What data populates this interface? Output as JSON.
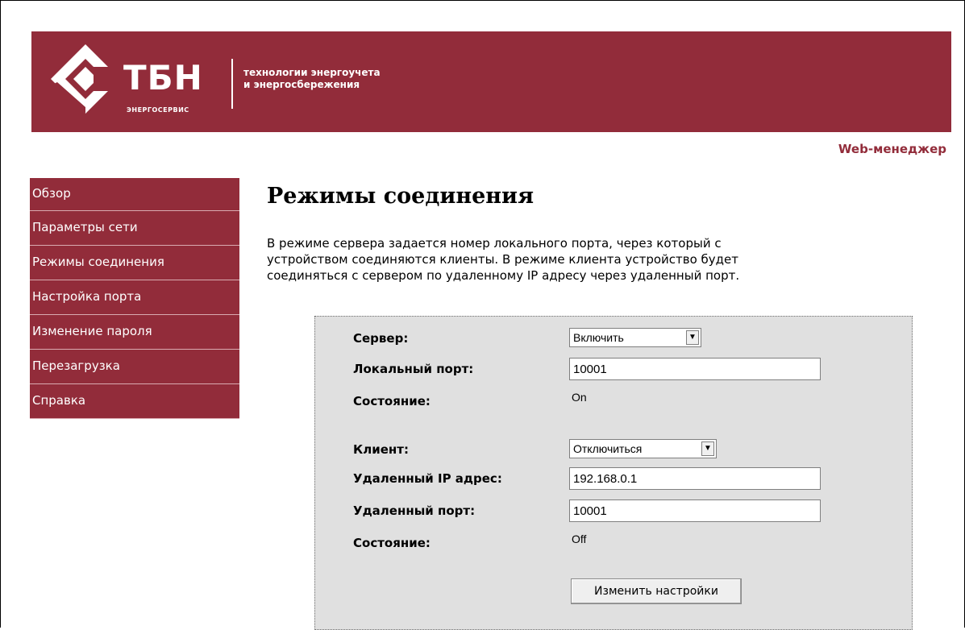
{
  "header": {
    "logo_text": "ТБН",
    "logo_sub": "ЭНЕРГОСЕРВИС",
    "tagline_line1": "технологии энергоучета",
    "tagline_line2": "и энергосбережения",
    "web_manager": "Web-менеджер"
  },
  "sidebar": {
    "items": [
      {
        "label": "Обзор"
      },
      {
        "label": "Параметры сети"
      },
      {
        "label": "Режимы соединения"
      },
      {
        "label": "Настройка порта"
      },
      {
        "label": "Изменение пароля"
      },
      {
        "label": "Перезагрузка"
      },
      {
        "label": "Справка"
      }
    ]
  },
  "main": {
    "title": "Режимы соединения",
    "intro_line1": "В режиме сервера задается номер локального порта, через который с",
    "intro_line2": "устройством соединяются клиенты. В режиме клиента устройство будет",
    "intro_line3": "соединяться с сервером по удаленному IP адресу через удаленный порт."
  },
  "form": {
    "server_label": "Сервер:",
    "server_value": "Включить",
    "local_port_label": "Локальный порт:",
    "local_port_value": "10001",
    "server_state_label": "Состояние:",
    "server_state_value": "On",
    "client_label": "Клиент:",
    "client_value": "Отключиться",
    "remote_ip_label": "Удаленный IP адрес:",
    "remote_ip_value": "192.168.0.1",
    "remote_port_label": "Удаленный порт:",
    "remote_port_value": "10001",
    "client_state_label": "Состояние:",
    "client_state_value": "Off",
    "apply_button": "Изменить настройки"
  },
  "colors": {
    "brand": "#922c3a",
    "panel_bg": "#e0e0e0"
  },
  "icons": {
    "logo": "tbn-logo-icon",
    "dropdown": "chevron-down-icon"
  }
}
